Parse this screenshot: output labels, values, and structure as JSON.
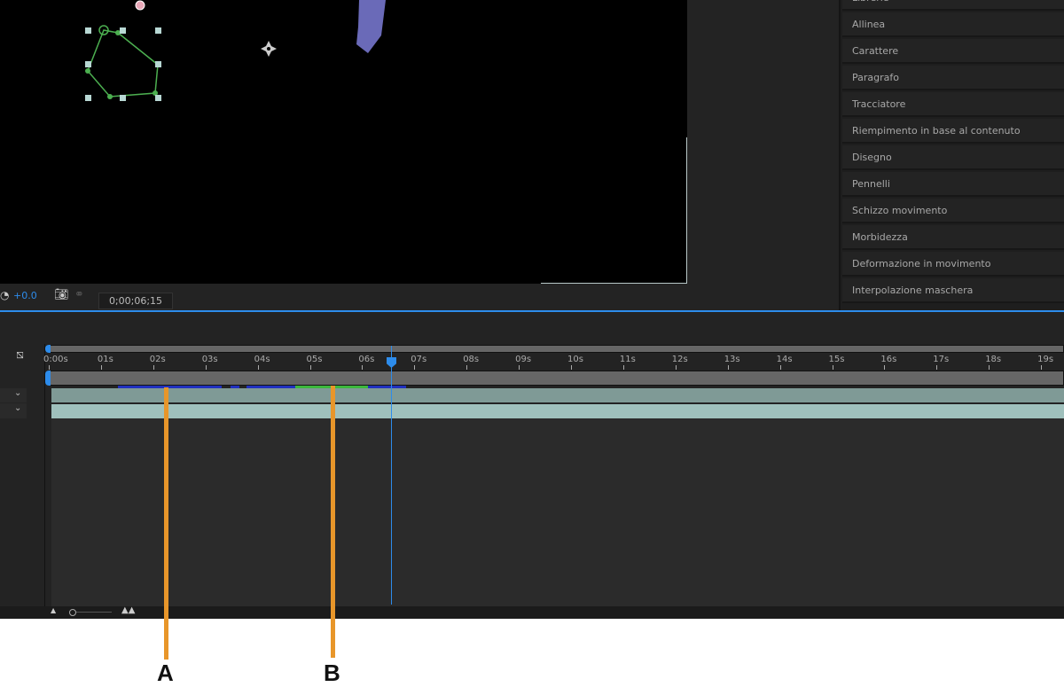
{
  "viewer": {
    "exposure": "+0.0",
    "timecode": "0;00;06;15"
  },
  "panel": {
    "items": [
      "Librerie",
      "Allinea",
      "Carattere",
      "Paragrafo",
      "Tracciatore",
      "Riempimento in base al contenuto",
      "Disegno",
      "Pennelli",
      "Schizzo movimento",
      "Morbidezza",
      "Deformazione in movimento",
      "Interpolazione maschera"
    ]
  },
  "timeline": {
    "ruler": [
      "0:00s",
      "01s",
      "02s",
      "03s",
      "04s",
      "05s",
      "06s",
      "07s",
      "08s",
      "09s",
      "10s",
      "11s",
      "12s",
      "13s",
      "14s",
      "15s",
      "16s",
      "17s",
      "18s",
      "19s"
    ],
    "playhead_seconds": 6.5
  },
  "annotations": {
    "a": "A",
    "b": "B"
  },
  "colors": {
    "accent": "#2d8ceb",
    "marker": "#e8962a",
    "mask": "#4caf50"
  }
}
